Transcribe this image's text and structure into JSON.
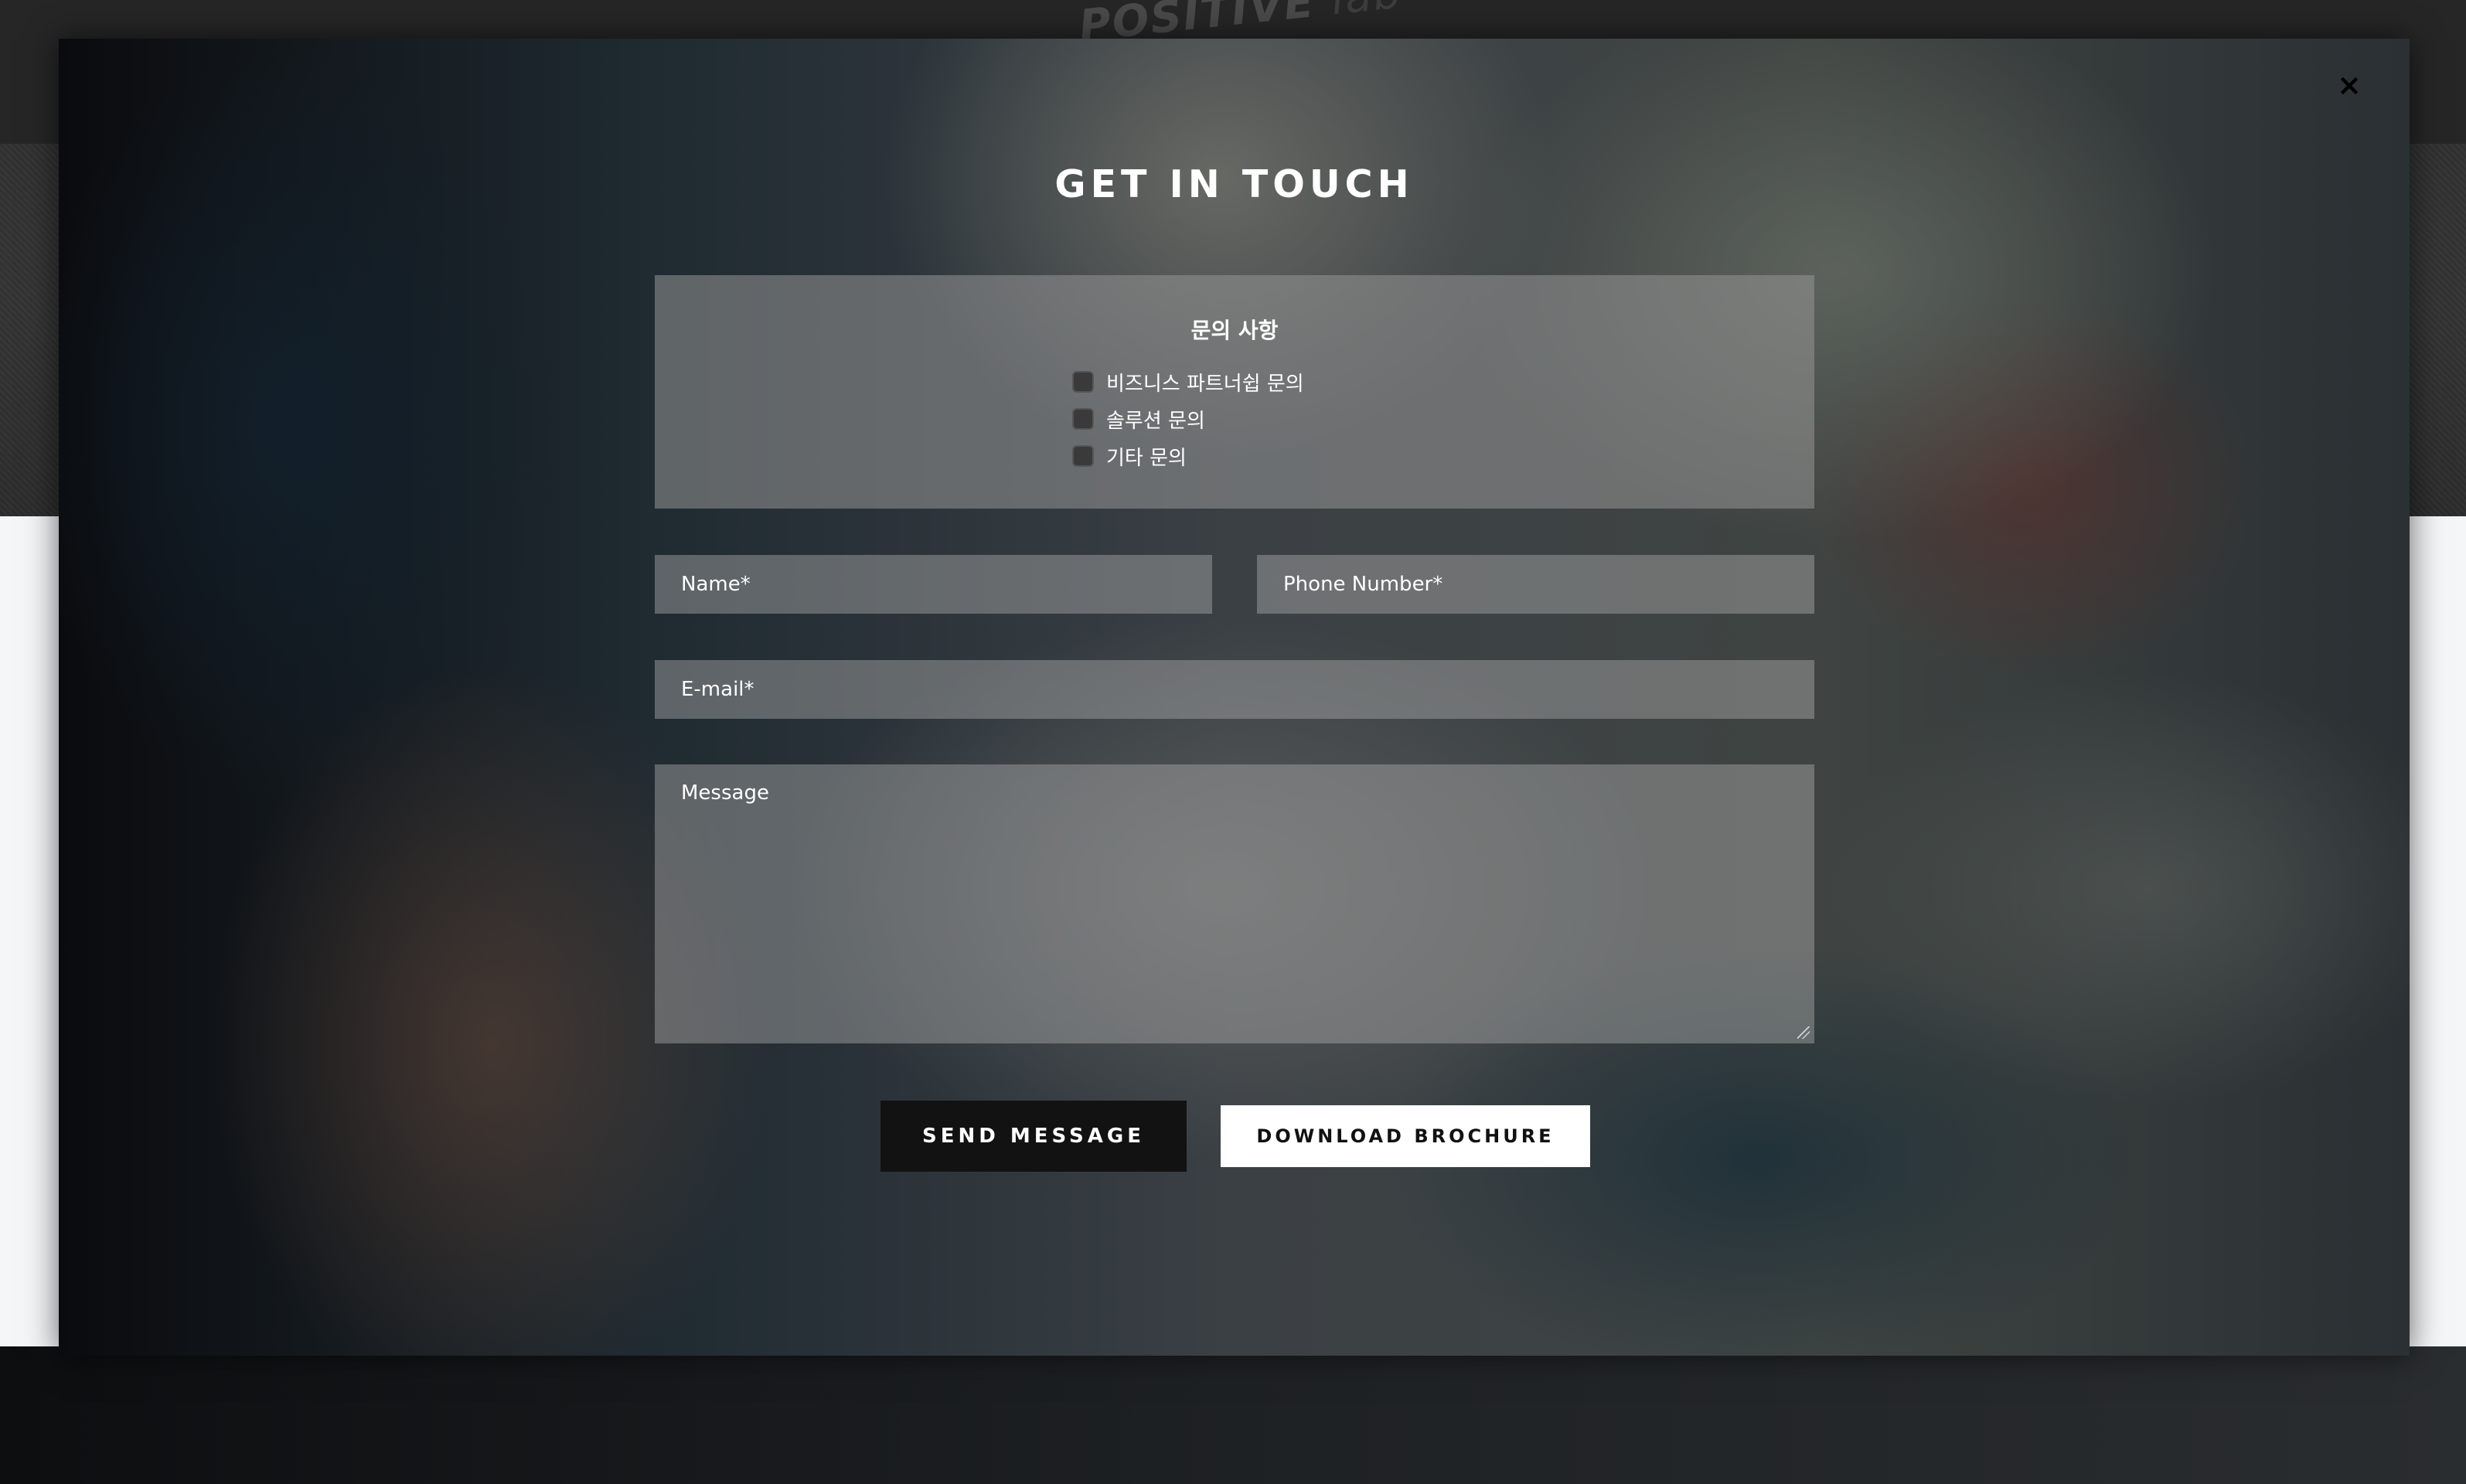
{
  "background": {
    "logo_word": "POSITIVE",
    "logo_suffix": "lab"
  },
  "modal": {
    "close_icon": "×",
    "title": "GET IN TOUCH",
    "inquiry": {
      "title": "문의 사항",
      "options": [
        {
          "label": "비즈니스 파트너쉽 문의",
          "checked": false
        },
        {
          "label": "솔루션 문의",
          "checked": false
        },
        {
          "label": "기타 문의",
          "checked": false
        }
      ]
    },
    "fields": {
      "name_placeholder": "Name*",
      "phone_placeholder": "Phone Number*",
      "email_placeholder": "E-mail*",
      "message_placeholder": "Message"
    },
    "buttons": {
      "send": "SEND MESSAGE",
      "brochure": "DOWNLOAD BROCHURE"
    }
  }
}
